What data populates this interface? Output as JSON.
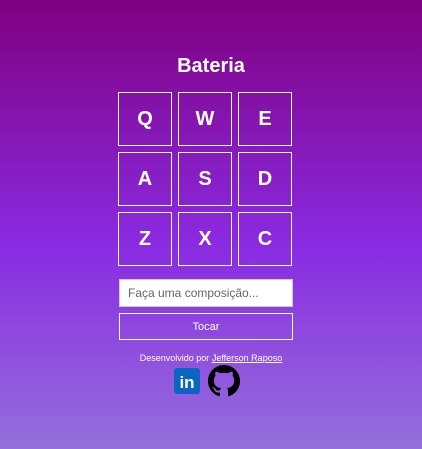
{
  "app": {
    "title": "Bateria"
  },
  "keys": [
    {
      "label": "Q"
    },
    {
      "label": "W"
    },
    {
      "label": "E"
    },
    {
      "label": "A"
    },
    {
      "label": "S"
    },
    {
      "label": "D"
    },
    {
      "label": "Z"
    },
    {
      "label": "X"
    },
    {
      "label": "C"
    }
  ],
  "composition": {
    "value": "",
    "placeholder": "Faça uma composição..."
  },
  "play_button": {
    "label": "Tocar"
  },
  "footer": {
    "credit_prefix": "Desenvolvido por",
    "author_link": "Jefferson Raposo",
    "socials": [
      {
        "icon": "linkedin-icon",
        "label": "in",
        "color": "#0a66c2"
      },
      {
        "icon": "github-icon",
        "color": "#000000"
      }
    ]
  },
  "colors": {
    "gradient_top": "#800080",
    "gradient_mid": "#8a2be2",
    "gradient_bottom": "#9370db",
    "text": "#ffffff"
  }
}
